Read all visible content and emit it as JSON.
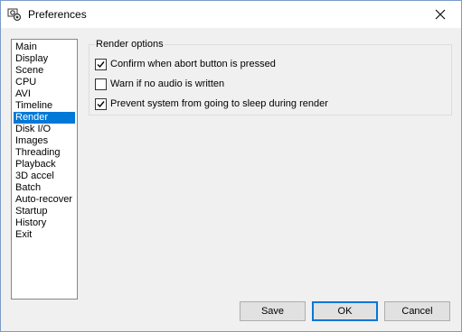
{
  "window": {
    "title": "Preferences"
  },
  "sidebar": {
    "items": [
      {
        "label": "Main"
      },
      {
        "label": "Display"
      },
      {
        "label": "Scene"
      },
      {
        "label": "CPU"
      },
      {
        "label": "AVI"
      },
      {
        "label": "Timeline"
      },
      {
        "label": "Render",
        "selected": true
      },
      {
        "label": "Disk I/O"
      },
      {
        "label": "Images"
      },
      {
        "label": "Threading"
      },
      {
        "label": "Playback"
      },
      {
        "label": "3D accel"
      },
      {
        "label": "Batch"
      },
      {
        "label": "Auto-recover"
      },
      {
        "label": "Startup"
      },
      {
        "label": "History"
      },
      {
        "label": "Exit"
      }
    ]
  },
  "render_options": {
    "group_label": "Render options",
    "options": [
      {
        "label": "Confirm when abort button is pressed",
        "checked": true
      },
      {
        "label": "Warn if no audio is written",
        "checked": false
      },
      {
        "label": "Prevent system from going to sleep during render",
        "checked": true
      }
    ]
  },
  "buttons": {
    "save_label": "Save",
    "ok_label": "OK",
    "cancel_label": "Cancel"
  },
  "colors": {
    "selection": "#0078d7",
    "window_bg": "#f0f0f0"
  },
  "icons": {
    "app": "gear-icon",
    "close": "close-icon",
    "check": "checkmark-icon"
  }
}
